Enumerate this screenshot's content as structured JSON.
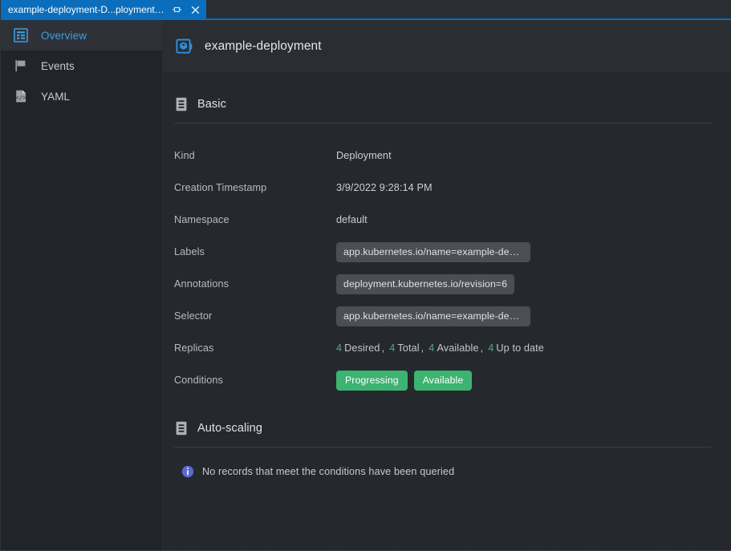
{
  "window": {
    "tab": {
      "title": "example-deployment-D...ployment-...",
      "pin_icon": "pin-icon",
      "close_icon": "close-icon"
    }
  },
  "sidebar": {
    "items": [
      {
        "label": "Overview",
        "icon": "overview-icon",
        "active": true
      },
      {
        "label": "Events",
        "icon": "flag-icon",
        "active": false
      },
      {
        "label": "YAML",
        "icon": "code-file-icon",
        "active": false
      }
    ]
  },
  "header": {
    "title": "example-deployment",
    "icon": "deployment-cube-icon"
  },
  "sections": {
    "basic": {
      "title": "Basic",
      "icon": "document-list-icon",
      "fields": [
        {
          "label": "Kind",
          "value": "Deployment",
          "type": "text"
        },
        {
          "label": "Creation Timestamp",
          "value": "3/9/2022 9:28:14 PM",
          "type": "text"
        },
        {
          "label": "Namespace",
          "value": "default",
          "type": "text"
        },
        {
          "label": "Labels",
          "value": "app.kubernetes.io/name=example-deplo...",
          "type": "chip"
        },
        {
          "label": "Annotations",
          "value": "deployment.kubernetes.io/revision=6",
          "type": "chip"
        },
        {
          "label": "Selector",
          "value": "app.kubernetes.io/name=example-deplo...",
          "type": "chip"
        }
      ],
      "replicas": {
        "label": "Replicas",
        "items": [
          {
            "count": "4",
            "text": "Desired"
          },
          {
            "count": "4",
            "text": "Total"
          },
          {
            "count": "4",
            "text": "Available"
          },
          {
            "count": "4",
            "text": "Up to date"
          }
        ],
        "separator": ","
      },
      "conditions": {
        "label": "Conditions",
        "badges": [
          "Progressing",
          "Available"
        ]
      }
    },
    "autoscaling": {
      "title": "Auto-scaling",
      "icon": "document-list-icon",
      "empty_message": "No records that meet the conditions have been queried",
      "empty_icon": "info-icon"
    }
  },
  "colors": {
    "accent_blue": "#0a6ebd",
    "link_blue": "#3c9de0",
    "success_green": "#3cb371",
    "replica_green": "#4caf7d",
    "chip_gray": "#4b4e54",
    "bg_dark": "#25282c",
    "bg_sidebar": "#212428",
    "bg_header": "#2a2d32"
  }
}
